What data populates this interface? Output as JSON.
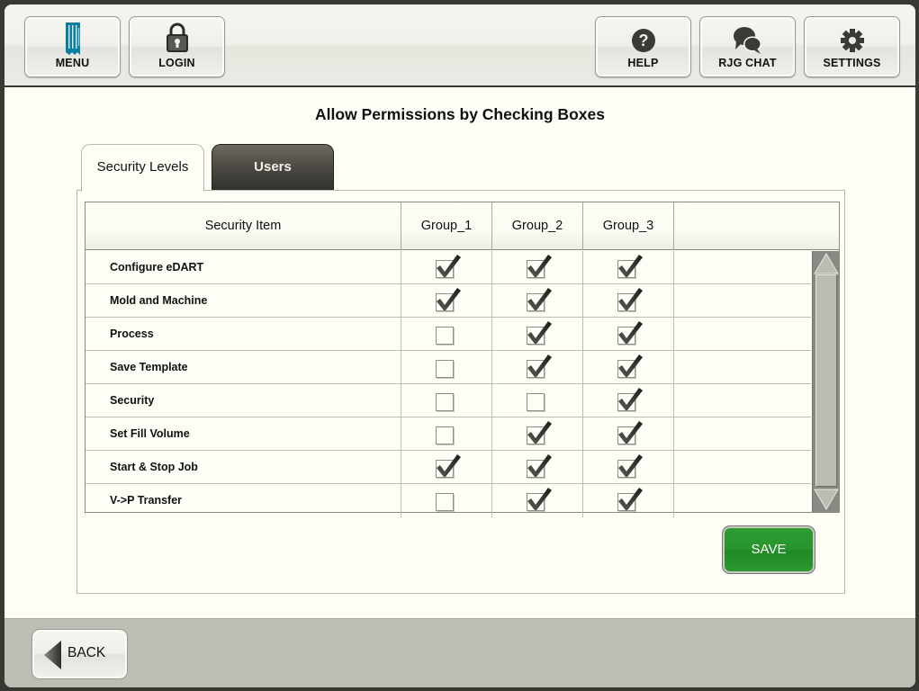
{
  "topbar": {
    "left_buttons": [
      {
        "label": "MENU",
        "icon": "rjg-menu-icon"
      },
      {
        "label": "LOGIN",
        "icon": "lock-icon"
      }
    ],
    "right_buttons": [
      {
        "label": "HELP",
        "icon": "help-icon"
      },
      {
        "label": "RJG CHAT",
        "icon": "chat-icon"
      },
      {
        "label": "SETTINGS",
        "icon": "gear-icon"
      }
    ]
  },
  "page": {
    "title": "Allow Permissions by Checking Boxes"
  },
  "tabs": [
    {
      "label": "Security Levels",
      "active": true
    },
    {
      "label": "Users",
      "active": false
    }
  ],
  "table": {
    "columns": [
      "Security Item",
      "Group_1",
      "Group_2",
      "Group_3",
      ""
    ],
    "rows": [
      {
        "item": "Configure eDART",
        "permissions": [
          true,
          true,
          true
        ]
      },
      {
        "item": "Mold and Machine",
        "permissions": [
          true,
          true,
          true
        ]
      },
      {
        "item": "Process",
        "permissions": [
          false,
          true,
          true
        ]
      },
      {
        "item": "Save Template",
        "permissions": [
          false,
          true,
          true
        ]
      },
      {
        "item": "Security",
        "permissions": [
          false,
          false,
          true
        ]
      },
      {
        "item": "Set Fill Volume",
        "permissions": [
          false,
          true,
          true
        ]
      },
      {
        "item": "Start & Stop Job",
        "permissions": [
          true,
          true,
          true
        ]
      },
      {
        "item": "V->P Transfer",
        "permissions": [
          false,
          true,
          true
        ]
      }
    ]
  },
  "actions": {
    "save_label": "SAVE",
    "back_label": "BACK"
  },
  "colors": {
    "save_green": "#27952c",
    "menu_icon_blue": "#0b7ca4",
    "background": "#fefef6",
    "inactive_tab": "#4c4943"
  }
}
